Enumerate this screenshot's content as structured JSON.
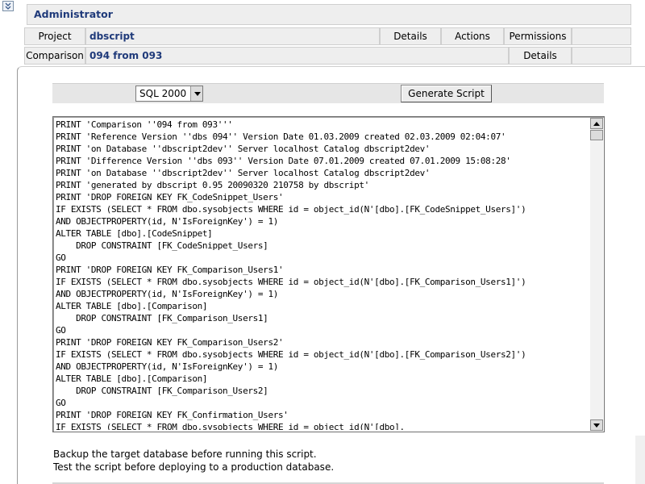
{
  "header": {
    "role": "Administrator",
    "project_label": "Project",
    "project_name": "dbscript",
    "project_actions": [
      "Details",
      "Actions",
      "Permissions"
    ],
    "comparison_label": "Comparison",
    "comparison_name": "094 from 093",
    "comparison_actions": [
      "Details"
    ]
  },
  "toolbar": {
    "dialect_selected": "SQL 2000",
    "generate_label": "Generate Script"
  },
  "script_lines": [
    "PRINT 'Comparison ''094 from 093'''",
    "PRINT 'Reference Version ''dbs 094'' Version Date 01.03.2009 created 02.03.2009 02:04:07'",
    "PRINT 'on Database ''dbscript2dev'' Server localhost Catalog dbscript2dev'",
    "PRINT 'Difference Version ''dbs 093'' Version Date 07.01.2009 created 07.01.2009 15:08:28'",
    "PRINT 'on Database ''dbscript2dev'' Server localhost Catalog dbscript2dev'",
    "PRINT 'generated by dbscript 0.95 20090320 210758 by dbscript'",
    "PRINT 'DROP FOREIGN KEY FK_CodeSnippet_Users'",
    "IF EXISTS (SELECT * FROM dbo.sysobjects WHERE id = object_id(N'[dbo].[FK_CodeSnippet_Users]')",
    "AND OBJECTPROPERTY(id, N'IsForeignKey') = 1)",
    "ALTER TABLE [dbo].[CodeSnippet]",
    "    DROP CONSTRAINT [FK_CodeSnippet_Users]",
    "GO",
    "PRINT 'DROP FOREIGN KEY FK_Comparison_Users1'",
    "IF EXISTS (SELECT * FROM dbo.sysobjects WHERE id = object_id(N'[dbo].[FK_Comparison_Users1]')",
    "AND OBJECTPROPERTY(id, N'IsForeignKey') = 1)",
    "ALTER TABLE [dbo].[Comparison]",
    "    DROP CONSTRAINT [FK_Comparison_Users1]",
    "GO",
    "PRINT 'DROP FOREIGN KEY FK_Comparison_Users2'",
    "IF EXISTS (SELECT * FROM dbo.sysobjects WHERE id = object_id(N'[dbo].[FK_Comparison_Users2]')",
    "AND OBJECTPROPERTY(id, N'IsForeignKey') = 1)",
    "ALTER TABLE [dbo].[Comparison]",
    "    DROP CONSTRAINT [FK_Comparison_Users2]",
    "GO",
    "PRINT 'DROP FOREIGN KEY FK_Confirmation_Users'",
    "IF EXISTS (SELECT * FROM dbo.sysobjects WHERE id = object_id(N'[dbo]."
  ],
  "notes": {
    "backup": "Backup the target database before running this script.",
    "test": "Test the script before deploying to a production database."
  },
  "icons": {
    "collapse": "double-chevron-down-icon"
  },
  "colors": {
    "link_text": "#1f3a7a",
    "header_bg": "#eeeeee"
  }
}
